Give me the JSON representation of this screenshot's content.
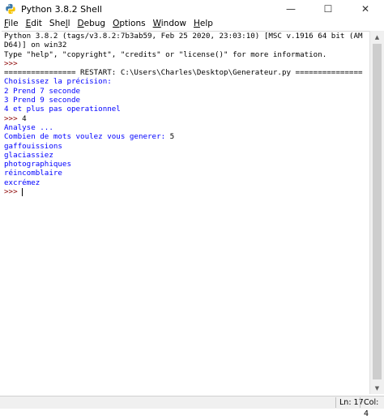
{
  "window": {
    "title": "Python 3.8.2 Shell",
    "controls": {
      "minimize": "—",
      "maximize": "☐",
      "close": "✕"
    }
  },
  "menu": {
    "items": [
      {
        "first": "F",
        "rest": "ile"
      },
      {
        "first": "E",
        "rest": "dit"
      },
      {
        "pre": "She",
        "first": "l",
        "rest": "l"
      },
      {
        "first": "D",
        "rest": "ebug"
      },
      {
        "first": "O",
        "rest": "ptions"
      },
      {
        "first": "W",
        "rest": "indow"
      },
      {
        "first": "H",
        "rest": "elp"
      }
    ]
  },
  "shell": {
    "lines": [
      {
        "text": "Python 3.8.2 (tags/v3.8.2:7b3ab59, Feb 25 2020, 23:03:10) [MSC v.1916 64 bit (AM",
        "color": "black"
      },
      {
        "text": "D64)] on win32",
        "color": "black"
      },
      {
        "text": "Type \"help\", \"copyright\", \"credits\" or \"license()\" for more information.",
        "color": "black"
      },
      {
        "text": ">>> ",
        "color": "prompt"
      },
      {
        "text": "================ RESTART: C:\\Users\\Charles\\Desktop\\Generateur.py ===============",
        "color": "restart"
      },
      {
        "text": "Choisissez la précision:",
        "color": "blue"
      },
      {
        "text": "2 Prend 7 seconde",
        "color": "blue"
      },
      {
        "text": "3 Prend 9 seconde",
        "color": "blue"
      },
      {
        "text": "4 et plus pas operationnel",
        "color": "blue"
      },
      {
        "text": ">>> 4",
        "color": "prompt-input",
        "prompt": ">>> ",
        "input": "4"
      },
      {
        "text": "Analyse ...",
        "color": "blue"
      },
      {
        "text": "Combien de mots voulez vous generer: 5",
        "color": "blue-input",
        "label": "Combien de mots voulez vous generer: ",
        "input": "5"
      },
      {
        "text": "gaffouissions",
        "color": "blue"
      },
      {
        "text": "glaciassiez",
        "color": "blue"
      },
      {
        "text": "photographiques",
        "color": "blue"
      },
      {
        "text": "réincomblaire",
        "color": "blue"
      },
      {
        "text": "excrémez",
        "color": "blue"
      },
      {
        "text": ">>> ",
        "color": "prompt"
      }
    ]
  },
  "status": {
    "line": "Ln: 17",
    "col": "Col: 4"
  },
  "colors": {
    "prompt": "#8b0000",
    "output": "#0000ff",
    "text": "#000000"
  }
}
